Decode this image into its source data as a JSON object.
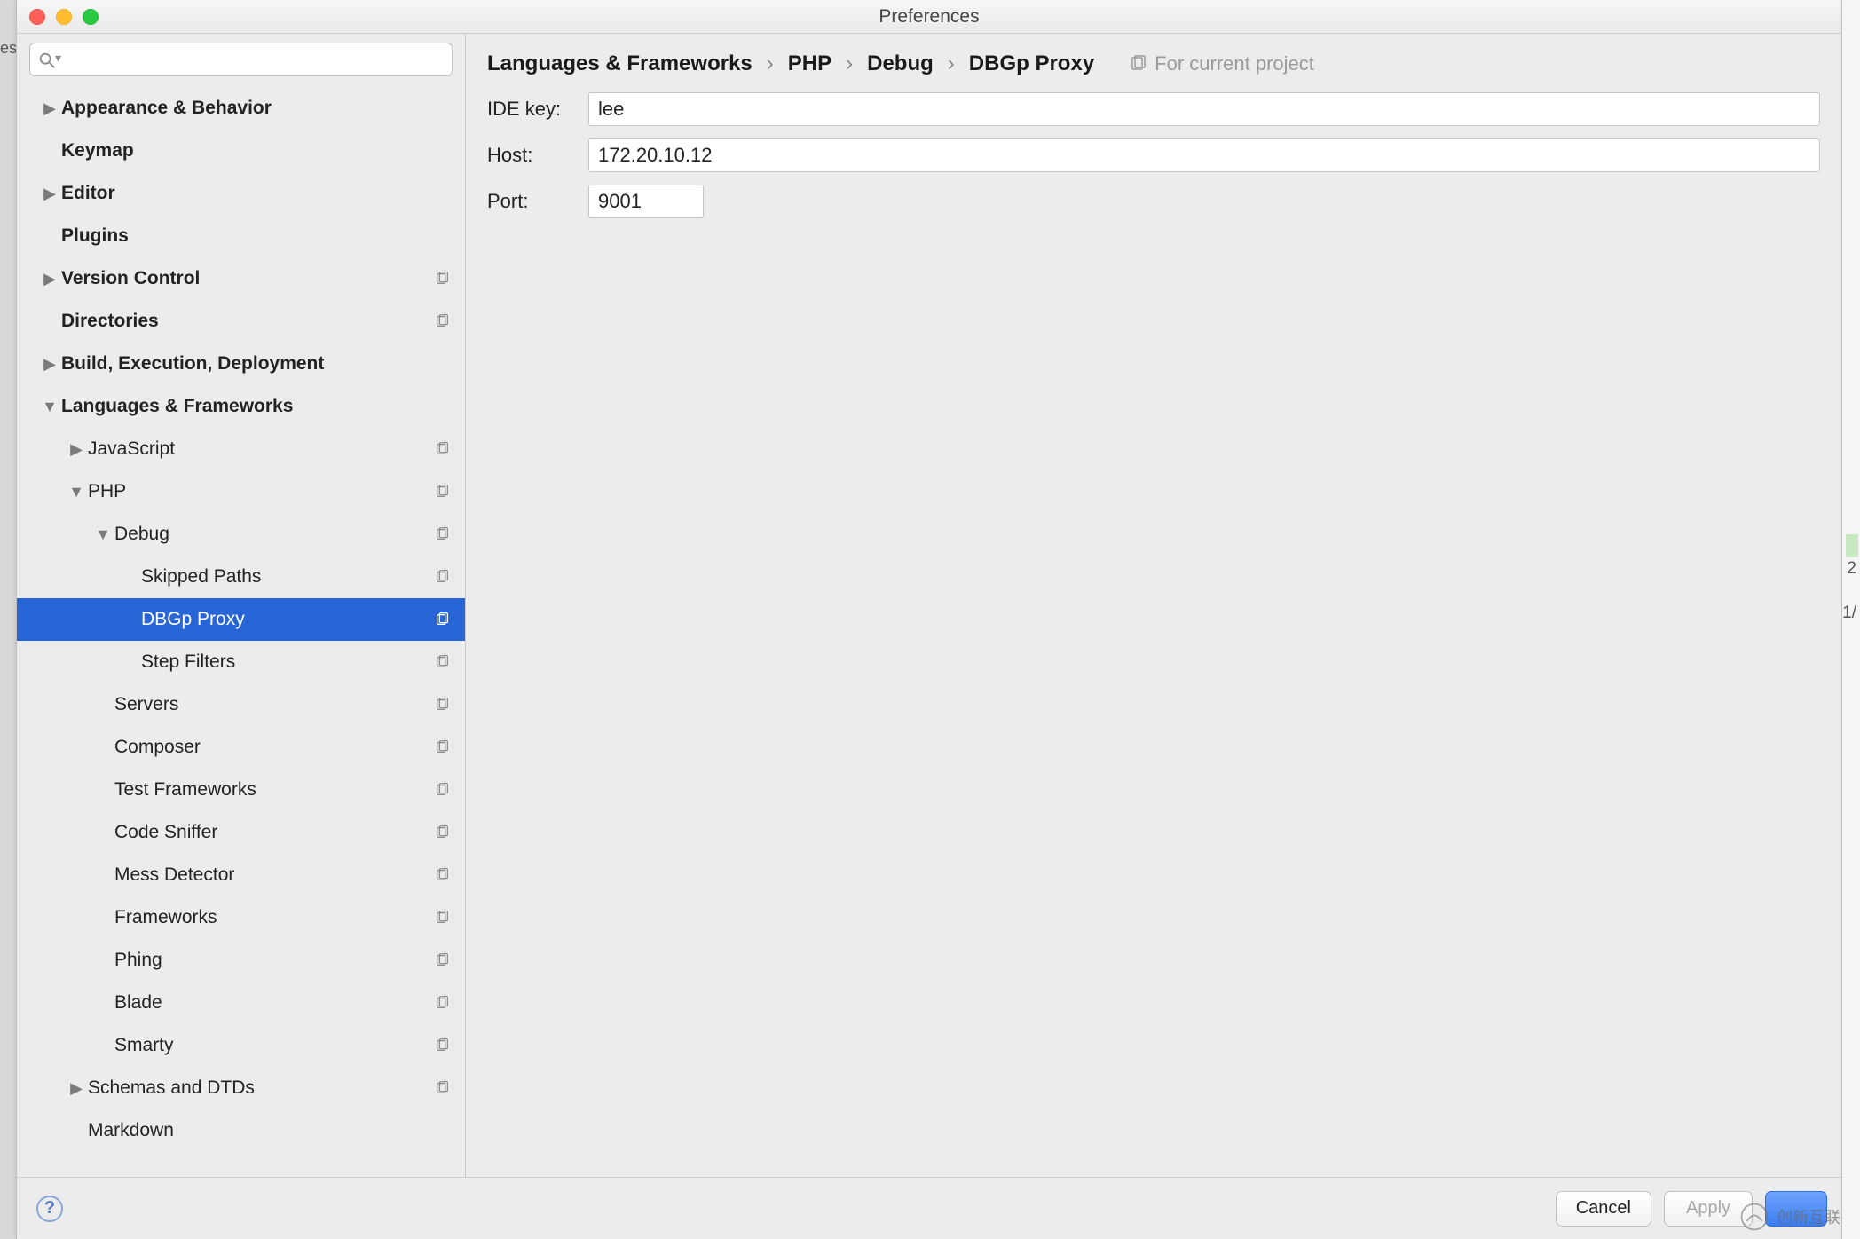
{
  "window": {
    "title": "Preferences"
  },
  "bg": {
    "left_text": "es",
    "right_mark1": "2",
    "right_mark2": "1/"
  },
  "search": {
    "placeholder": ""
  },
  "sidebar": {
    "items": [
      {
        "label": "Appearance & Behavior",
        "indent": 0,
        "arrow": "right",
        "bold": true,
        "badge": false
      },
      {
        "label": "Keymap",
        "indent": 0,
        "arrow": "",
        "bold": true,
        "badge": false
      },
      {
        "label": "Editor",
        "indent": 0,
        "arrow": "right",
        "bold": true,
        "badge": false
      },
      {
        "label": "Plugins",
        "indent": 0,
        "arrow": "",
        "bold": true,
        "badge": false
      },
      {
        "label": "Version Control",
        "indent": 0,
        "arrow": "right",
        "bold": true,
        "badge": true
      },
      {
        "label": "Directories",
        "indent": 0,
        "arrow": "",
        "bold": true,
        "badge": true
      },
      {
        "label": "Build, Execution, Deployment",
        "indent": 0,
        "arrow": "right",
        "bold": true,
        "badge": false
      },
      {
        "label": "Languages & Frameworks",
        "indent": 0,
        "arrow": "down",
        "bold": true,
        "badge": false
      },
      {
        "label": "JavaScript",
        "indent": 1,
        "arrow": "right",
        "bold": false,
        "badge": true
      },
      {
        "label": "PHP",
        "indent": 1,
        "arrow": "down",
        "bold": false,
        "badge": true
      },
      {
        "label": "Debug",
        "indent": 2,
        "arrow": "down",
        "bold": false,
        "badge": true
      },
      {
        "label": "Skipped Paths",
        "indent": 3,
        "arrow": "",
        "bold": false,
        "badge": true
      },
      {
        "label": "DBGp Proxy",
        "indent": 3,
        "arrow": "",
        "bold": false,
        "badge": true,
        "selected": true
      },
      {
        "label": "Step Filters",
        "indent": 3,
        "arrow": "",
        "bold": false,
        "badge": true
      },
      {
        "label": "Servers",
        "indent": 2,
        "arrow": "",
        "bold": false,
        "badge": true
      },
      {
        "label": "Composer",
        "indent": 2,
        "arrow": "",
        "bold": false,
        "badge": true
      },
      {
        "label": "Test Frameworks",
        "indent": 2,
        "arrow": "",
        "bold": false,
        "badge": true
      },
      {
        "label": "Code Sniffer",
        "indent": 2,
        "arrow": "",
        "bold": false,
        "badge": true
      },
      {
        "label": "Mess Detector",
        "indent": 2,
        "arrow": "",
        "bold": false,
        "badge": true
      },
      {
        "label": "Frameworks",
        "indent": 2,
        "arrow": "",
        "bold": false,
        "badge": true
      },
      {
        "label": "Phing",
        "indent": 2,
        "arrow": "",
        "bold": false,
        "badge": true
      },
      {
        "label": "Blade",
        "indent": 2,
        "arrow": "",
        "bold": false,
        "badge": true
      },
      {
        "label": "Smarty",
        "indent": 2,
        "arrow": "",
        "bold": false,
        "badge": true
      },
      {
        "label": "Schemas and DTDs",
        "indent": 1,
        "arrow": "right",
        "bold": false,
        "badge": true
      },
      {
        "label": "Markdown",
        "indent": 1,
        "arrow": "",
        "bold": false,
        "badge": false
      }
    ]
  },
  "breadcrumb": {
    "items": [
      "Languages & Frameworks",
      "PHP",
      "Debug",
      "DBGp Proxy"
    ],
    "scope_label": "For current project"
  },
  "form": {
    "ide_key": {
      "label": "IDE key:",
      "value": "lee"
    },
    "host": {
      "label": "Host:",
      "value": "172.20.10.12"
    },
    "port": {
      "label": "Port:",
      "value": "9001"
    }
  },
  "footer": {
    "help": "?",
    "cancel": "Cancel",
    "apply": "Apply",
    "ok": ""
  },
  "watermark": "创新互联"
}
